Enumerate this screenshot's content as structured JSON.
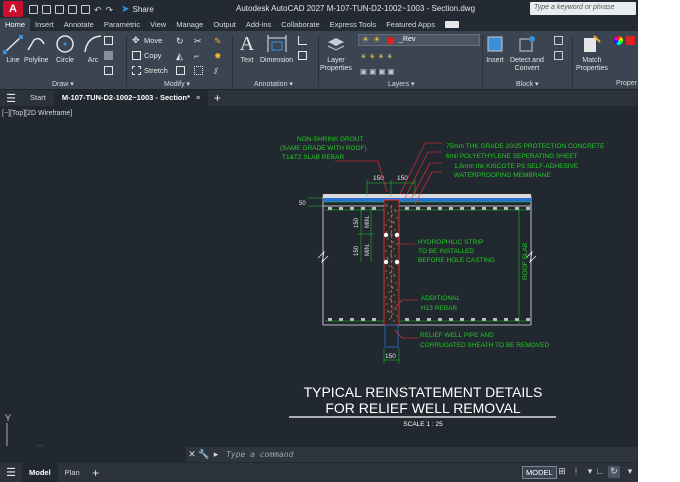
{
  "titlebar": {
    "app_letter": "A",
    "share_label": "Share",
    "window_title": "Autodesk AutoCAD 2027   M-107-TUN-D2-1002~1003 - Section.dwg",
    "search_placeholder": "Type a keyword or phrase"
  },
  "ribbon_tabs": [
    "Home",
    "Insert",
    "Annotate",
    "Parametric",
    "View",
    "Manage",
    "Output",
    "Add-ins",
    "Collaborate",
    "Express Tools",
    "Featured Apps"
  ],
  "ribbon": {
    "draw": {
      "label": "Draw ▾",
      "line": "Line",
      "polyline": "Polyline",
      "circle": "Circle",
      "arc": "Arc"
    },
    "modify": {
      "label": "Modify ▾",
      "move": "Move",
      "copy": "Copy",
      "stretch": "Stretch"
    },
    "annotation": {
      "label": "Annotation ▾",
      "text": "Text",
      "dimension": "Dimension"
    },
    "layers": {
      "label": "Layers ▾",
      "layer_properties": "Layer\nProperties",
      "current_layer": "_Rev"
    },
    "block": {
      "label": "Block ▾",
      "insert": "Insert",
      "detect": "Detect and\nConvert"
    },
    "properties": {
      "label": "Proper",
      "match": "Match\nProperties"
    }
  },
  "file_tabs": {
    "start": "Start",
    "current": "M-107-TUN-D2-1002~1003 - Section*",
    "close": "×"
  },
  "viewport_label": "[−][Top][2D Wireframe]",
  "drawing": {
    "notes_left": [
      "NON-SHRINK GROUT",
      "(SAME GRADE WITH ROOF)",
      "T1&T2 SLAB REBAR"
    ],
    "notes_right": [
      "75mm THK GRADE 20/25 PROTECTION CONCRETE",
      "6mil POLYETHYLENE SEPERATING SHEET",
      "1.5mm thk KISCOTE PS SELF-ADHESIVE",
      "WATERPROOFING MEMBRANE"
    ],
    "hydrophilic": [
      "HYDROPHILIC STRIP",
      "TO BE INSTALLED",
      "BEFORE HOLE CASTING"
    ],
    "additional": [
      "ADDITIONAL",
      "H13 REBAR"
    ],
    "relief": [
      "RELIEF WELL PIPE AND",
      "CORRUGATED SHEATH TO BE REMOVED"
    ],
    "dim_150": "150",
    "dim_50": "50",
    "min_label": "MIN.",
    "roof_slab": "ROOF SLAB",
    "title_line1": "TYPICAL REINSTATEMENT DETAILS",
    "title_line2": "FOR RELIEF WELL REMOVAL",
    "scale": "SCALE 1 : 25",
    "ucs_x": "X",
    "ucs_y": "Y"
  },
  "command": {
    "placeholder": "Type a command"
  },
  "statusbar": {
    "model": "Model",
    "plan": "Plan",
    "model_button": "MODEL"
  },
  "colors": {
    "drawing_bg": "#212830",
    "annotation": "#22cc22",
    "section": "#e8e8e8",
    "rebar": "#ff3030",
    "membrane": "#2a6fd6"
  }
}
